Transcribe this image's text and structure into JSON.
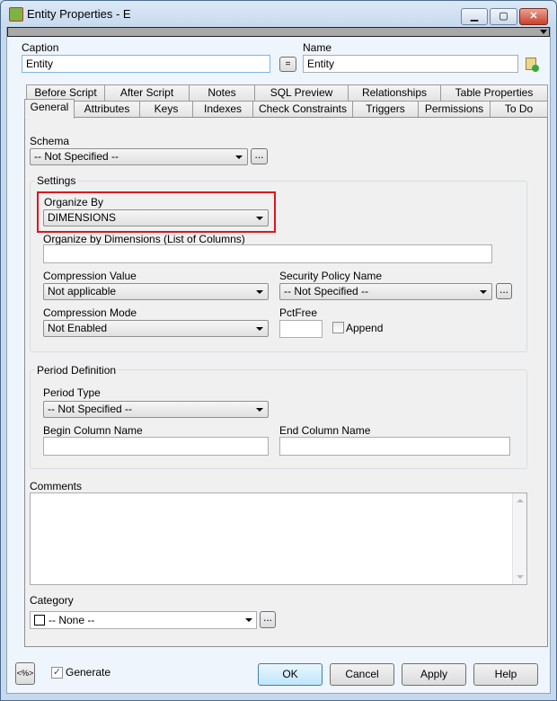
{
  "window": {
    "title": "Entity Properties - E",
    "minimize": "▁",
    "maximize": "▢",
    "close": "✕"
  },
  "header": {
    "caption_label": "Caption",
    "caption_value": "Entity",
    "equals_button": "=",
    "name_label": "Name",
    "name_value": "Entity"
  },
  "tabs_row1": [
    "Before Script",
    "After Script",
    "Notes",
    "SQL Preview",
    "Relationships",
    "Table Properties"
  ],
  "tabs_row2": [
    "General",
    "Attributes",
    "Keys",
    "Indexes",
    "Check Constraints",
    "Triggers",
    "Permissions",
    "To Do"
  ],
  "general": {
    "schema_label": "Schema",
    "schema_value": "-- Not Specified --",
    "ellipsis": "...",
    "settings_label": "Settings",
    "organize_by_label": "Organize By",
    "organize_by_value": "DIMENSIONS",
    "organize_dims_label": "Organize by Dimensions (List of Columns)",
    "organize_dims_value": "",
    "compression_value_label": "Compression Value",
    "compression_value": "Not applicable",
    "security_policy_label": "Security Policy Name",
    "security_policy_value": "-- Not Specified --",
    "compression_mode_label": "Compression Mode",
    "compression_mode_value": "Not Enabled",
    "pctfree_label": "PctFree",
    "pctfree_value": "",
    "append_label": "Append",
    "period_label": "Period Definition",
    "period_type_label": "Period Type",
    "period_type_value": "-- Not Specified --",
    "begin_col_label": "Begin Column Name",
    "begin_col_value": "",
    "end_col_label": "End Column Name",
    "end_col_value": "",
    "comments_label": "Comments",
    "comments_value": "",
    "category_label": "Category",
    "category_value": "-- None --"
  },
  "footer": {
    "macro_button": "<%>",
    "generate_label": "Generate",
    "ok": "OK",
    "cancel": "Cancel",
    "apply": "Apply",
    "help": "Help"
  },
  "colors": {
    "highlight": "#e0141e"
  }
}
